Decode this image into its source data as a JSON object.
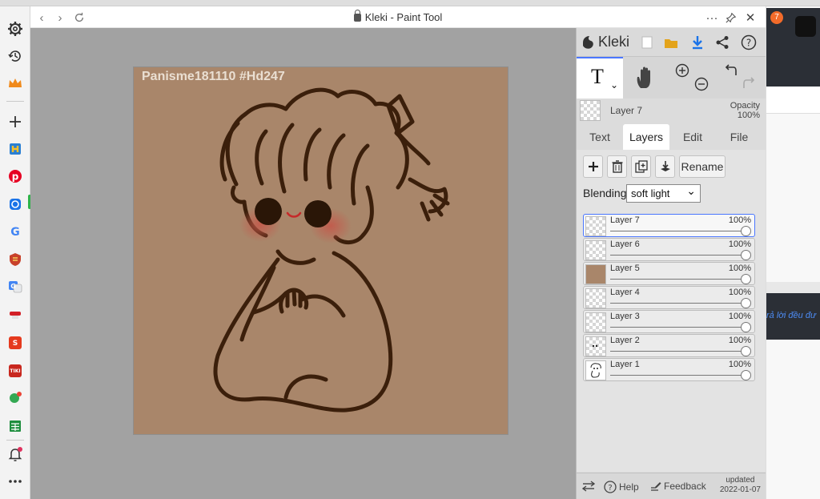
{
  "window": {
    "title": "Kleki - Paint Tool"
  },
  "canvas": {
    "watermark": "Panisme181110 #Hd247"
  },
  "panel": {
    "brand": "Kleki",
    "current_layer": {
      "name": "Layer 7",
      "opacity_label": "Opacity",
      "opacity_value": "100%"
    },
    "tabs": [
      {
        "label": "Text"
      },
      {
        "label": "Layers"
      },
      {
        "label": "Edit"
      },
      {
        "label": "File"
      }
    ],
    "active_tab": "Layers",
    "layer_buttons": {
      "rename": "Rename"
    },
    "blending": {
      "label": "Blending",
      "value": "soft light"
    },
    "layers": [
      {
        "name": "Layer 7",
        "opacity": "100%"
      },
      {
        "name": "Layer 6",
        "opacity": "100%"
      },
      {
        "name": "Layer 5",
        "opacity": "100%"
      },
      {
        "name": "Layer 4",
        "opacity": "100%"
      },
      {
        "name": "Layer 3",
        "opacity": "100%"
      },
      {
        "name": "Layer 2",
        "opacity": "100%"
      },
      {
        "name": "Layer 1",
        "opacity": "100%"
      }
    ],
    "bottom": {
      "help": "Help",
      "feedback": "Feedback",
      "updated_label": "updated",
      "updated_date": "2022-01-07"
    }
  },
  "right_edge": {
    "badge": "7",
    "snippet": "rả lời đều đư"
  }
}
